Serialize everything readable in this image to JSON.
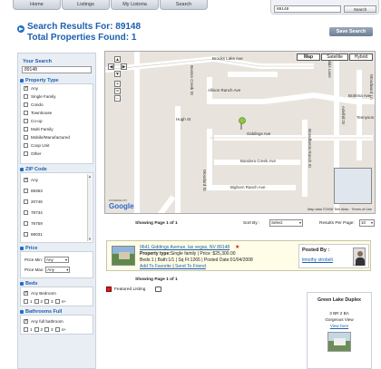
{
  "nav": {
    "tabs": [
      "Home",
      "Listings",
      "My Listoria",
      "Search"
    ]
  },
  "top_search": {
    "value": "89148",
    "button": "Search"
  },
  "header": {
    "title": "Search Results For: 89148",
    "subtitle": "Total Properties Found: 1",
    "save_button": "Save Search"
  },
  "sidebar": {
    "your_search": {
      "title": "Your Search",
      "value": "89148"
    },
    "property_type": {
      "title": "Property Type",
      "options": [
        {
          "label": "Any",
          "checked": true
        },
        {
          "label": "Single Family",
          "checked": false
        },
        {
          "label": "Condo",
          "checked": false
        },
        {
          "label": "Townhouse",
          "checked": false
        },
        {
          "label": "Co-op",
          "checked": false
        },
        {
          "label": "Multi Family",
          "checked": false
        },
        {
          "label": "Mobile/Manufactured",
          "checked": false
        },
        {
          "label": "Coop Unit",
          "checked": false
        },
        {
          "label": "Other",
          "checked": false
        }
      ]
    },
    "zip_code": {
      "title": "ZIP Code",
      "options": [
        {
          "label": "Any",
          "checked": true
        },
        {
          "label": "89363",
          "checked": false
        },
        {
          "label": "20746",
          "checked": false
        },
        {
          "label": "78734",
          "checked": false
        },
        {
          "label": "78759",
          "checked": false
        },
        {
          "label": "89031",
          "checked": false
        }
      ]
    },
    "price": {
      "title": "Price",
      "min_label": "Price Min:",
      "min_value": "Any",
      "max_label": "Price Max:",
      "max_value": "Any"
    },
    "beds": {
      "title": "Beds",
      "any_label": "Any Bedroom",
      "nums": [
        "1",
        "2",
        "3",
        "4+"
      ]
    },
    "baths": {
      "title": "Bathrooms Full",
      "any_label": "Any full bathroom",
      "nums": [
        "1",
        "2",
        "3",
        "4+"
      ]
    }
  },
  "map": {
    "types": [
      "Map",
      "Satellite",
      "Hybrid"
    ],
    "streets": [
      "Brooks Lake Ave",
      "Allison Ranch Ave",
      "Boston Creek St",
      "Hugh St",
      "Woodward Ln",
      "Giddings Ave",
      "Bandera Creek Ave",
      "Broadbents Ranch St",
      "Woodard St",
      "Bighorn Ranch Ave",
      "Tennyson",
      "Adelhill Dr",
      "Brahma Ave",
      "Calais Lane"
    ],
    "footer": "Map data ©2008 Tele Atlas · Terms of Use",
    "powered_by": "POWERED BY",
    "logo": "Google"
  },
  "results_bar": {
    "page_text": "Showing Page 1 of 1",
    "sort_label": "Sort By :",
    "sort_value": "Select",
    "rpp_label": "Results Per Page:",
    "rpp_value": "10"
  },
  "listing": {
    "address": "9641 Giddings Avenue, las vegas, NV 89148",
    "line1_label": "Property type:",
    "line1_value": "Single family | Price :$25,300.00",
    "line2": "Beds:1 | Bath:1/1 | Sq Ft:1265 | Posted Date:01/04/2008",
    "link_fav": "Add To Favorite",
    "link_sep": "|",
    "link_friend": "Send To Friend",
    "posted_by_label": "Posted By :",
    "posted_by": "timothy strobelt"
  },
  "bottom_page_text": "Showing Page 1 of 1",
  "legend": {
    "featured": "Featured Listing"
  },
  "featured_card": {
    "title": "Green Lake Duplex",
    "beds": "3 BR 2 BA",
    "desc": "Gorgeous View",
    "link": "View here"
  }
}
